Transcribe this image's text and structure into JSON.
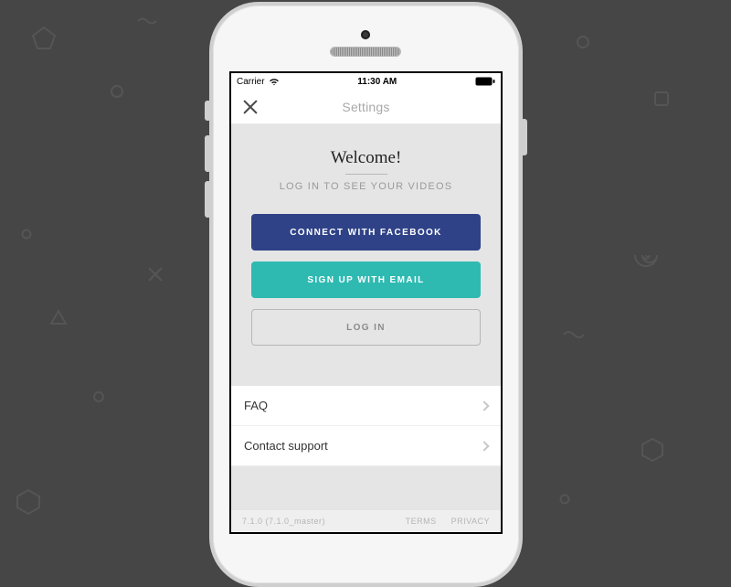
{
  "statusbar": {
    "carrier": "Carrier",
    "time": "11:30 AM"
  },
  "navbar": {
    "title": "Settings"
  },
  "welcome": {
    "headline": "Welcome!",
    "sub": "LOG IN TO SEE YOUR VIDEOS"
  },
  "buttons": {
    "facebook": "CONNECT WITH FACEBOOK",
    "email": "SIGN UP WITH EMAIL",
    "login": "LOG IN"
  },
  "rows": {
    "faq": "FAQ",
    "support": "Contact support"
  },
  "footer": {
    "version": "7.1.0 (7.1.0_master)",
    "terms": "TERMS",
    "privacy": "PRIVACY"
  }
}
